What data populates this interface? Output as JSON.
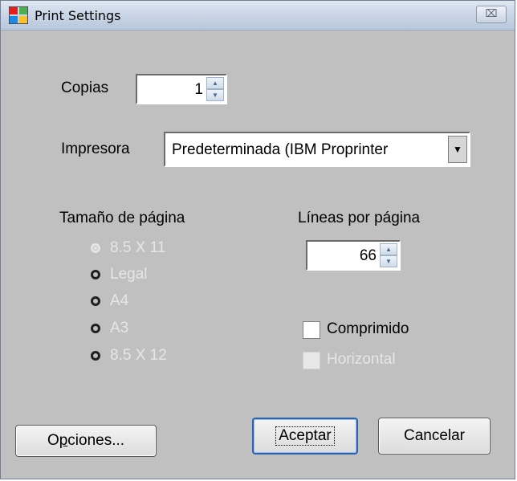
{
  "window": {
    "title": "Print Settings",
    "close_glyph": "⌧"
  },
  "copies": {
    "label": "Copias",
    "value": "1"
  },
  "printer": {
    "label": "Impresora",
    "value": "Predeterminada (IBM Proprinter"
  },
  "page_size": {
    "label": "Tamaño de página",
    "options": [
      "8.5 X 11",
      "Legal",
      "A4",
      "A3",
      "8.5 X 12"
    ],
    "selected": "8.5 X 11"
  },
  "lines_per_page": {
    "label": "Líneas por página",
    "value": "66"
  },
  "compressed": {
    "label": "Comprimido",
    "checked": false
  },
  "landscape": {
    "label": "Horizontal",
    "checked": false
  },
  "buttons": {
    "options_prefix": "O",
    "options_mnemonic": "p",
    "options_rest": "ciones...",
    "accept": "Aceptar",
    "cancel": "Cancelar"
  },
  "colors": {
    "dialog_bg": "#c0c0c0",
    "disabled_text": "#e6e6e6",
    "default_button_border": "#2c63b0"
  },
  "icons": {
    "app": "windows-logo-icon",
    "close": "close-icon",
    "dropdown": "chevron-down-icon",
    "spin_up": "arrow-up-icon",
    "spin_down": "arrow-down-icon"
  }
}
